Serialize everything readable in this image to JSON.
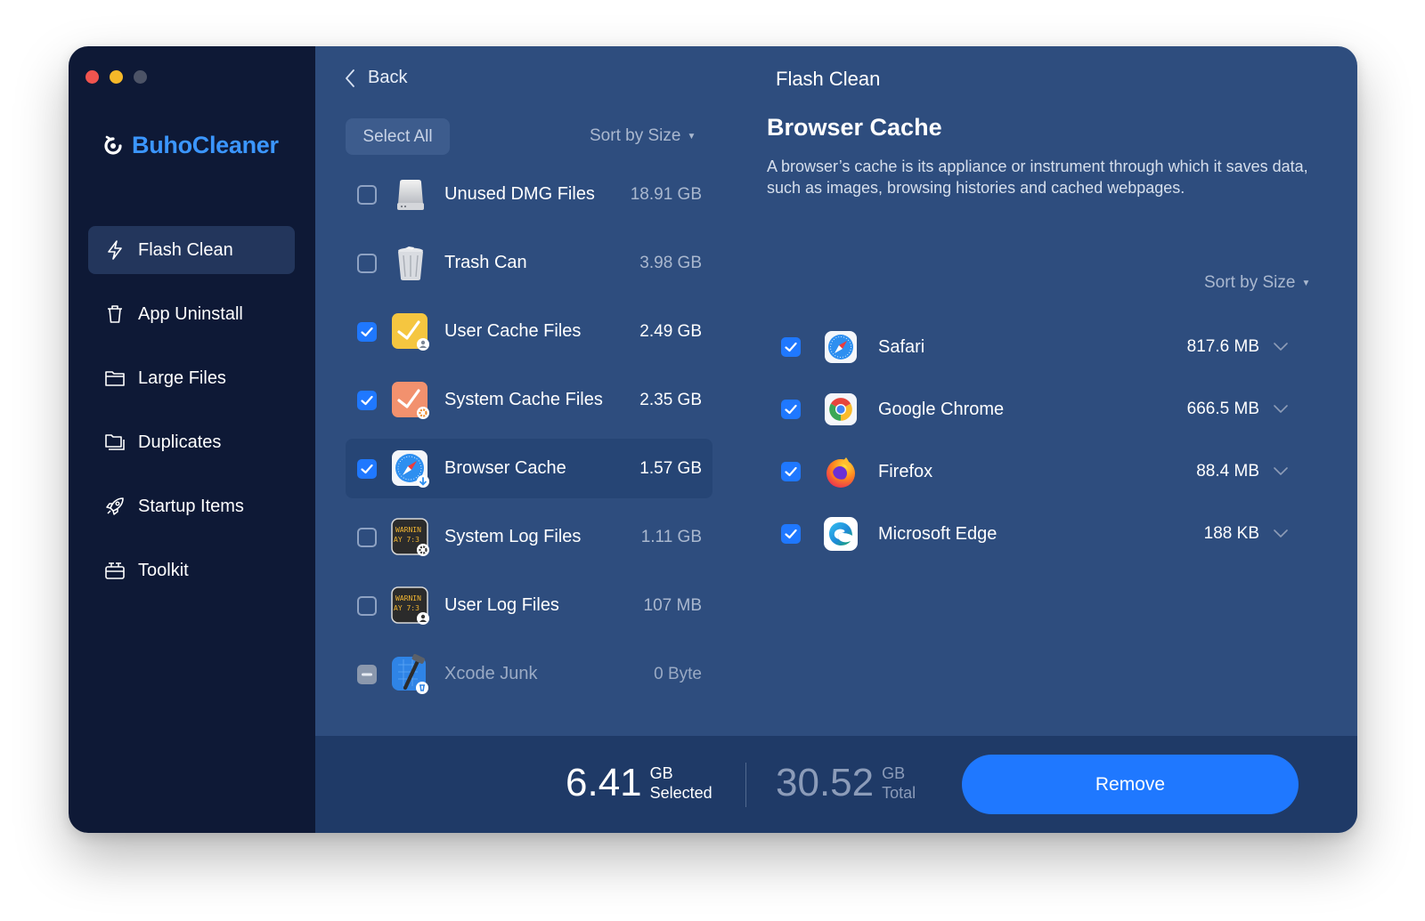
{
  "app": {
    "name": "BuhoCleaner"
  },
  "sidebar": {
    "items": [
      {
        "label": "Flash Clean",
        "icon": "flash-icon"
      },
      {
        "label": "App Uninstall",
        "icon": "trash-icon"
      },
      {
        "label": "Large Files",
        "icon": "folder-icon"
      },
      {
        "label": "Duplicates",
        "icon": "duplicate-folder-icon"
      },
      {
        "label": "Startup Items",
        "icon": "rocket-icon"
      },
      {
        "label": "Toolkit",
        "icon": "toolkit-icon"
      }
    ]
  },
  "header": {
    "back": "Back",
    "title": "Flash Clean"
  },
  "list": {
    "select_all": "Select All",
    "sort_label": "Sort by Size",
    "items": [
      {
        "name": "Unused DMG Files",
        "size": "18.91 GB",
        "icon": "disk-image-icon"
      },
      {
        "name": "Trash Can",
        "size": "3.98 GB",
        "icon": "trash-can-icon"
      },
      {
        "name": "User Cache Files",
        "size": "2.49 GB",
        "icon": "user-cache-icon"
      },
      {
        "name": "System Cache Files",
        "size": "2.35 GB",
        "icon": "system-cache-icon"
      },
      {
        "name": "Browser Cache",
        "size": "1.57 GB",
        "icon": "browser-cache-icon"
      },
      {
        "name": "System Log Files",
        "size": "1.11 GB",
        "icon": "system-log-icon"
      },
      {
        "name": "User Log Files",
        "size": "107 MB",
        "icon": "user-log-icon"
      },
      {
        "name": "Xcode Junk",
        "size": "0 Byte",
        "icon": "xcode-icon"
      }
    ]
  },
  "log_icon_text": {
    "line1": "WARNIN",
    "line2": "AY 7:3"
  },
  "detail": {
    "title": "Browser Cache",
    "description": "A browser’s cache is its appliance or instrument through which it saves data, such as images, browsing histories and cached webpages.",
    "sort_label": "Sort by Size",
    "browsers": [
      {
        "name": "Safari",
        "size": "817.6 MB",
        "icon": "safari-icon"
      },
      {
        "name": "Google Chrome",
        "size": "666.5 MB",
        "icon": "chrome-icon"
      },
      {
        "name": "Firefox",
        "size": "88.4 MB",
        "icon": "firefox-icon"
      },
      {
        "name": "Microsoft Edge",
        "size": "188 KB",
        "icon": "edge-icon"
      }
    ]
  },
  "footer": {
    "selected_value": "6.41",
    "selected_unit": "GB",
    "selected_label": "Selected",
    "total_value": "30.52",
    "total_unit": "GB",
    "total_label": "Total",
    "remove": "Remove"
  },
  "colors": {
    "accent": "#1f78ff",
    "sidebar_bg": "#0e1936",
    "main_bg": "#2e4d7e",
    "logo": "#3b96ff"
  }
}
